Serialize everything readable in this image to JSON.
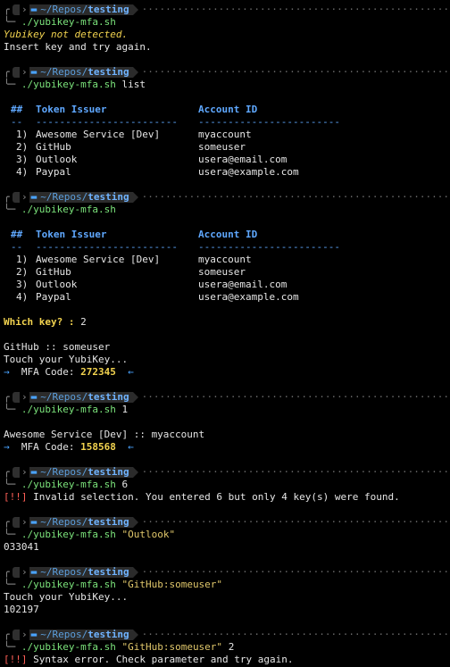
{
  "prompt": {
    "user_glyph": "",
    "separator": "›",
    "folder_glyph": "▬",
    "path_prefix": "~/Repos/",
    "path_dir": "testing"
  },
  "command": "./yubikey-mfa.sh",
  "blocks": [
    {
      "args": "",
      "output": {
        "error_italic": "Yubikey not detected.",
        "message": "Insert key and try again."
      }
    },
    {
      "args": "list"
    },
    {
      "args": ""
    },
    {
      "args": "1"
    },
    {
      "args": "6"
    },
    {
      "args": "\"Outlook\""
    },
    {
      "args": "\"GitHub:someuser\""
    },
    {
      "args": "\"GitHub:someuser\" 2"
    }
  ],
  "table": {
    "col_num": "##",
    "col_issuer": "Token Issuer",
    "col_account": "Account ID",
    "dash_num": "--",
    "dash_issuer": "------------------------",
    "dash_account": "------------------------",
    "rows": [
      {
        "n": "1)",
        "issuer": "Awesome Service [Dev]",
        "account": "myaccount"
      },
      {
        "n": "2)",
        "issuer": "GitHub",
        "account": "someuser"
      },
      {
        "n": "3)",
        "issuer": "Outlook",
        "account": "usera@email.com"
      },
      {
        "n": "4)",
        "issuer": "Paypal",
        "account": "usera@example.com"
      }
    ]
  },
  "which_key": {
    "label": "Which key? :",
    "value": "2"
  },
  "github_result": {
    "title": "GitHub :: someuser",
    "touch": "Touch your YubiKey...",
    "arrow_left": "→",
    "mfa_label": "MFA Code:",
    "code": "272345",
    "arrow_right": "←"
  },
  "awesome_result": {
    "title": "Awesome Service [Dev] :: myaccount",
    "arrow_left": "→",
    "mfa_label": "MFA Code:",
    "code": "158568",
    "arrow_right": "←"
  },
  "invalid": {
    "tag": "[!!]",
    "message": "Invalid selection. You entered 6 but only 4 key(s) were found."
  },
  "outlook_code": "033041",
  "github_direct": {
    "touch": "Touch your YubiKey...",
    "code": "102197"
  },
  "syntax_error": {
    "tag": "[!!]",
    "message": "Syntax error. Check parameter and try again."
  },
  "dots": "··································································"
}
